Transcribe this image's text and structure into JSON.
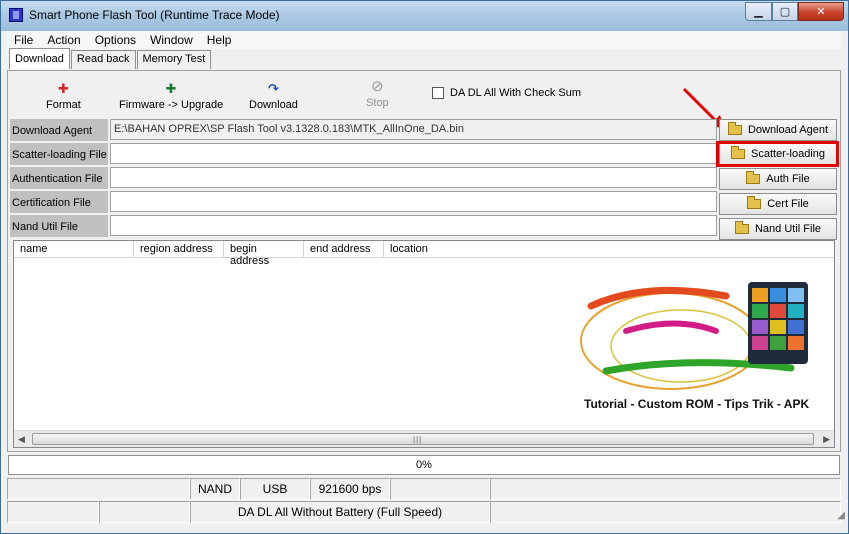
{
  "window": {
    "title": "Smart Phone Flash Tool (Runtime Trace Mode)",
    "controls": {
      "minimize": "▁",
      "maximize": "▢",
      "close": "✕"
    }
  },
  "menu": [
    "File",
    "Action",
    "Options",
    "Window",
    "Help"
  ],
  "tabs": [
    {
      "label": "Download",
      "active": true
    },
    {
      "label": "Read back",
      "active": false
    },
    {
      "label": "Memory Test",
      "active": false
    }
  ],
  "toolbar": {
    "format": {
      "label": "Format",
      "icon": "format-icon"
    },
    "firmware_upgrade": {
      "label": "Firmware -> Upgrade",
      "icon": "firmware-upgrade-icon"
    },
    "download": {
      "label": "Download",
      "icon": "download-icon"
    },
    "stop": {
      "label": "Stop",
      "icon": "stop-icon",
      "enabled": false
    },
    "checksum": {
      "label": "DA DL All With Check Sum",
      "checked": false
    }
  },
  "rows": [
    {
      "label": "Download Agent",
      "value": "E:\\BAHAN OPREX\\SP Flash Tool v3.1328.0.183\\MTK_AllInOne_DA.bin",
      "button": "Download Agent"
    },
    {
      "label": "Scatter-loading File",
      "value": "",
      "button": "Scatter-loading"
    },
    {
      "label": "Authentication File",
      "value": "",
      "button": "Auth File"
    },
    {
      "label": "Certification File",
      "value": "",
      "button": "Cert File"
    },
    {
      "label": "Nand Util File",
      "value": "",
      "button": "Nand Util File"
    }
  ],
  "table": {
    "columns": [
      "name",
      "region address",
      "begin address",
      "end address",
      "location"
    ],
    "rows": []
  },
  "watermark": {
    "caption": "Tutorial - Custom ROM - Tips Trik - APK"
  },
  "progress": {
    "value": 0,
    "label": "0%"
  },
  "status": {
    "storage": "NAND",
    "port": "USB",
    "baud": "921600 bps",
    "mode": "DA DL All Without Battery (Full Speed)"
  },
  "colors": {
    "highlight": "#e00000",
    "arrow": "#e00000",
    "titlebar": "#a9c8e4"
  }
}
